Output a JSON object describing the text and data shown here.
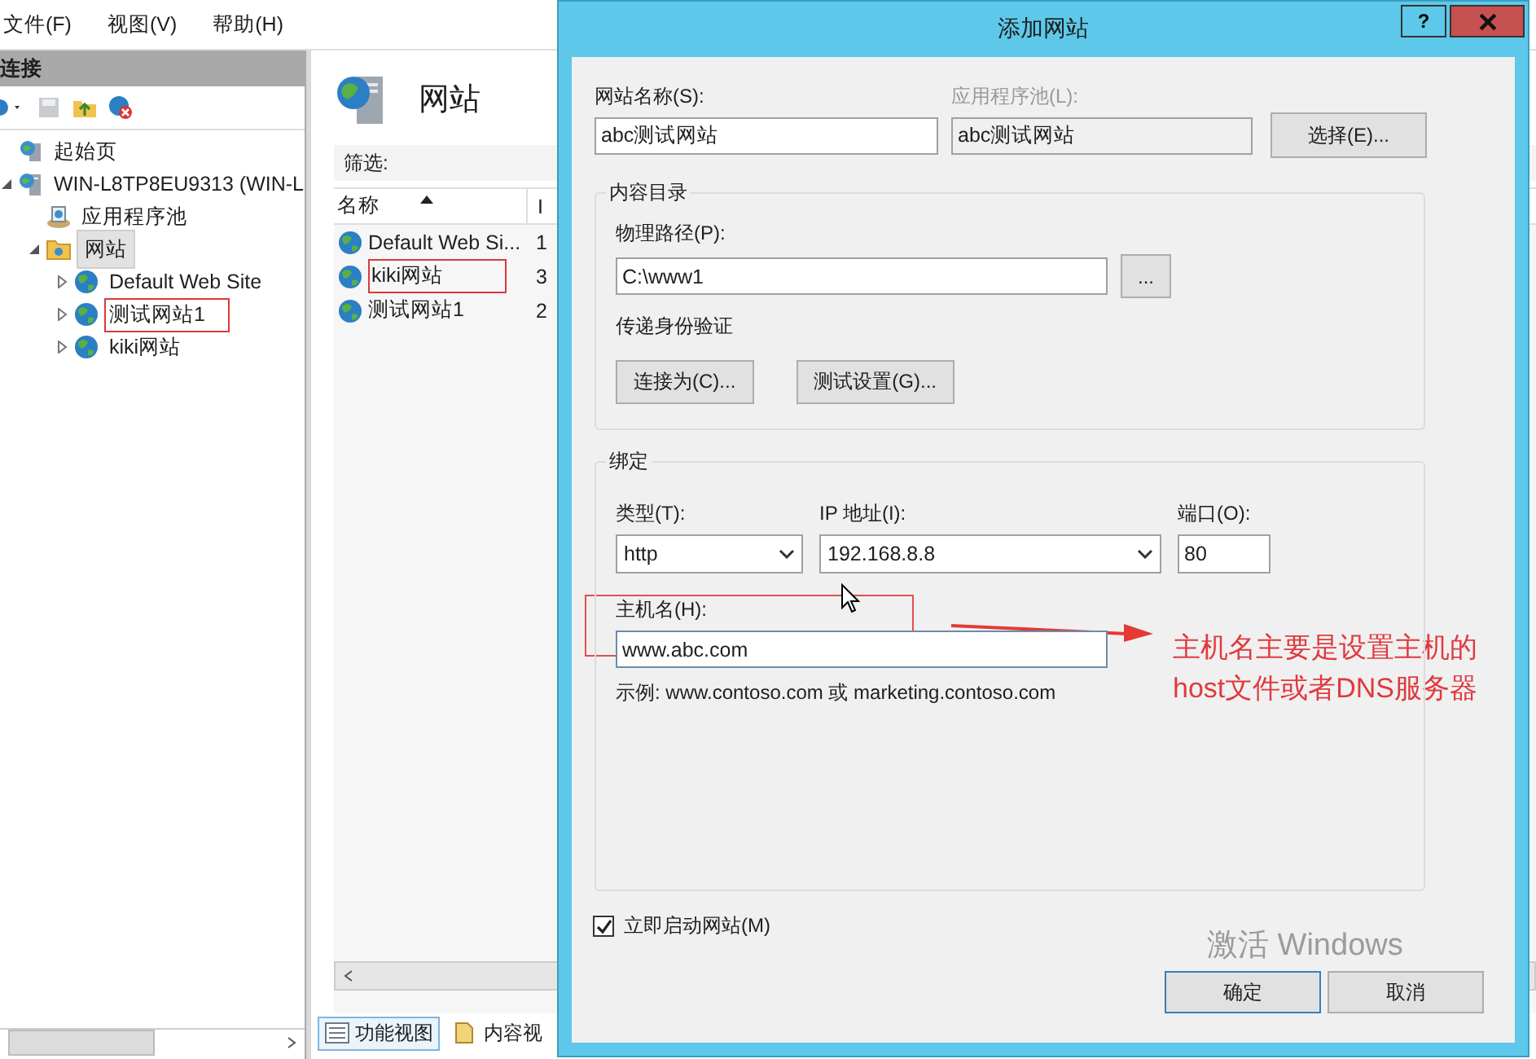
{
  "menu": [
    {
      "label": "文件(F)"
    },
    {
      "label": "视图(V)"
    },
    {
      "label": "帮助(H)"
    }
  ],
  "connections": {
    "title": "连接",
    "tree": [
      {
        "label": "起始页",
        "kind": "start",
        "selected": false,
        "annotated": false
      },
      {
        "label": "WIN-L8TP8EU9313 (WIN-L",
        "kind": "server",
        "expanded": true,
        "selected": false,
        "annotated": false,
        "children": [
          {
            "label": "应用程序池",
            "kind": "pool",
            "selected": false,
            "annotated": false
          },
          {
            "label": "网站",
            "kind": "folder",
            "expanded": true,
            "selected": true,
            "annotated": false,
            "children": [
              {
                "label": "Default Web Site",
                "kind": "site",
                "expanded": false,
                "selected": false,
                "annotated": false
              },
              {
                "label": "测试网站1",
                "kind": "site",
                "expanded": false,
                "selected": false,
                "annotated": true
              },
              {
                "label": "kiki网站",
                "kind": "site",
                "expanded": false,
                "selected": false,
                "annotated": false
              }
            ]
          }
        ]
      }
    ]
  },
  "sites_pane": {
    "title": "网站",
    "filter_label": "筛选:",
    "columns": [
      "名称",
      "I"
    ],
    "rows": [
      {
        "name": "Default Web Si...",
        "id": "1",
        "annotated": false
      },
      {
        "name": "kiki网站",
        "id": "3",
        "annotated": true
      },
      {
        "name": "测试网站1",
        "id": "2",
        "annotated": false
      }
    ],
    "view_tabs": [
      {
        "label": "功能视图",
        "selected": true
      },
      {
        "label": "内容视",
        "selected": false
      }
    ]
  },
  "dialog": {
    "title": "添加网站",
    "help": "?",
    "site_name": {
      "label": "网站名称(S):",
      "value": "abc测试网站"
    },
    "app_pool": {
      "label": "应用程序池(L):",
      "value": "abc测试网站",
      "disabled": true
    },
    "select_button": "选择(E)...",
    "content_dir": {
      "title": "内容目录",
      "path_label": "物理路径(P):",
      "path_value": "C:\\www1",
      "browse_button": "...",
      "auth_label": "传递身份验证",
      "buttons": [
        "连接为(C)...",
        "测试设置(G)..."
      ]
    },
    "binding": {
      "title": "绑定",
      "type_label": "类型(T):",
      "type_value": "http",
      "ip_label": "IP 地址(I):",
      "ip_value": "192.168.8.8",
      "port_label": "端口(O):",
      "port_value": "80",
      "host_label": "主机名(H):",
      "host_value": "www.abc.com",
      "host_annotated": true,
      "example": "示例: www.contoso.com 或 marketing.contoso.com"
    },
    "start_checkbox": {
      "label": "立即启动网站(M)",
      "checked": true
    },
    "buttons": [
      "确定",
      "取消"
    ],
    "annotation": "主机名主要是设置主机的\nhost文件或者DNS服务器",
    "activation": "激活 Windows"
  }
}
